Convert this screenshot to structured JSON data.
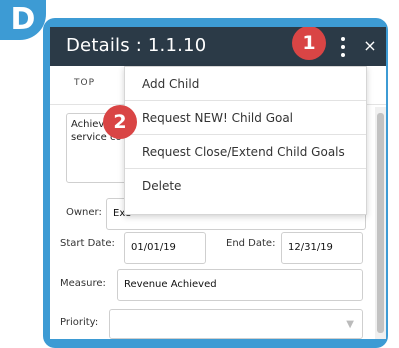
{
  "badge": {
    "letter": "D"
  },
  "header": {
    "title": "Details : 1.1.10",
    "more_icon": "kebab-vertical-icon",
    "close_icon": "close-icon",
    "close_glyph": "×"
  },
  "tabs": {
    "active": "TOP"
  },
  "form": {
    "description_line1": "Achiev",
    "description_line2": "service co",
    "owner_label": "Owner:",
    "owner_value": "Exe",
    "start_date_label": "Start Date:",
    "start_date_value": "01/01/19",
    "end_date_label": "End Date:",
    "end_date_value": "12/31/19",
    "measure_label": "Measure:",
    "measure_value": "Revenue Achieved",
    "priority_label": "Priority:",
    "priority_value": ""
  },
  "menu": {
    "items": [
      {
        "label": "Add Child"
      },
      {
        "label": "Request NEW! Child Goal"
      },
      {
        "label": "Request Close/Extend Child Goals"
      },
      {
        "label": "Delete"
      }
    ]
  },
  "callouts": {
    "first": "1",
    "second": "2"
  },
  "colors": {
    "frame": "#3d9bd4",
    "header": "#2b3a47",
    "callout": "#d94545"
  }
}
